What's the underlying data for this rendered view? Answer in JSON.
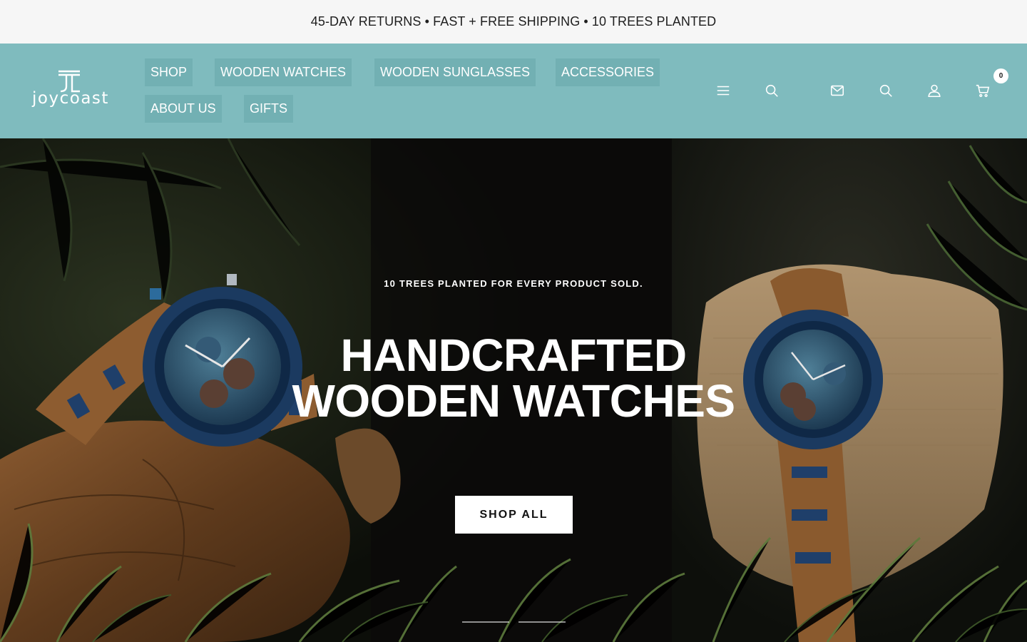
{
  "announcement": {
    "text": "45-DAY RETURNS • FAST + FREE SHIPPING • 10 TREES PLANTED"
  },
  "brand": {
    "name": "joycoast",
    "header_color": "#7fbbbe"
  },
  "nav": {
    "items": [
      {
        "label": "SHOP"
      },
      {
        "label": "WOODEN WATCHES"
      },
      {
        "label": "WOODEN SUNGLASSES"
      },
      {
        "label": "ACCESSORIES"
      },
      {
        "label": "ABOUT US"
      },
      {
        "label": "GIFTS"
      }
    ]
  },
  "header_icons": [
    "menu-icon",
    "search-icon",
    "mail-icon",
    "search-icon",
    "account-icon",
    "cart-icon"
  ],
  "cart": {
    "count": "0"
  },
  "hero": {
    "kicker": "10 TREES PLANTED FOR EVERY PRODUCT SOLD.",
    "title_line1": "HANDCRAFTED",
    "title_line2": "WOODEN WATCHES",
    "cta": "SHOP ALL",
    "slides": 2
  }
}
